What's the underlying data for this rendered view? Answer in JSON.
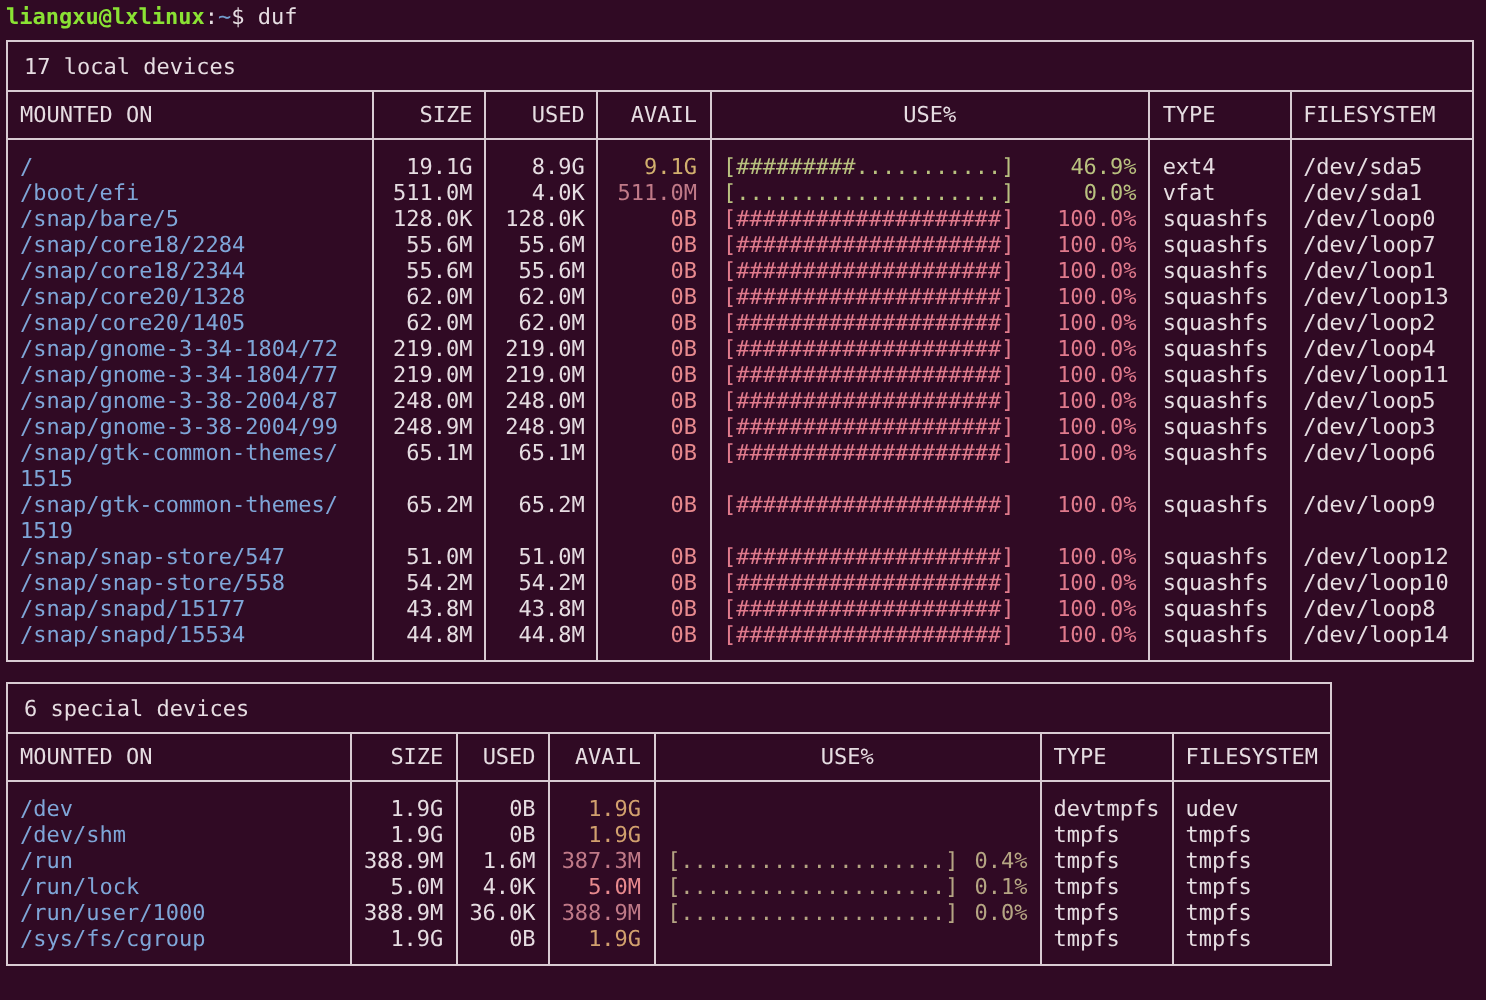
{
  "prompt": {
    "user_host": "liangxu@lxlinux",
    "separator": ":",
    "path": "~",
    "symbol": "$",
    "command": "duf"
  },
  "tables": [
    {
      "title": "17 local devices",
      "columns": [
        "MOUNTED ON",
        "SIZE",
        "USED",
        "AVAIL",
        "USE%",
        "TYPE",
        "FILESYSTEM"
      ],
      "rows": [
        {
          "mounted_on": "/",
          "size": "19.1G",
          "used": "8.9G",
          "avail": {
            "text": "9.1G",
            "color": "#d2b06e"
          },
          "use": {
            "bar": "[#########...........]",
            "percent": "46.9%",
            "color": "#b9c17f"
          },
          "type": "ext4",
          "filesystem": "/dev/sda5"
        },
        {
          "mounted_on": "/boot/efi",
          "size": "511.0M",
          "used": "4.0K",
          "avail": {
            "text": "511.0M",
            "color": "#c07a88"
          },
          "use": {
            "bar": "[....................]",
            "percent": "0.0%",
            "color": "#b9c17f"
          },
          "type": "vfat",
          "filesystem": "/dev/sda1"
        },
        {
          "mounted_on": "/snap/bare/5",
          "size": "128.0K",
          "used": "128.0K",
          "avail": {
            "text": "0B",
            "color": "#e88a8e"
          },
          "use": {
            "bar": "[####################]",
            "percent": "100.0%",
            "color": "#e07a8c"
          },
          "type": "squashfs",
          "filesystem": "/dev/loop0"
        },
        {
          "mounted_on": "/snap/core18/2284",
          "size": "55.6M",
          "used": "55.6M",
          "avail": {
            "text": "0B",
            "color": "#e88a8e"
          },
          "use": {
            "bar": "[####################]",
            "percent": "100.0%",
            "color": "#e07a8c"
          },
          "type": "squashfs",
          "filesystem": "/dev/loop7"
        },
        {
          "mounted_on": "/snap/core18/2344",
          "size": "55.6M",
          "used": "55.6M",
          "avail": {
            "text": "0B",
            "color": "#e88a8e"
          },
          "use": {
            "bar": "[####################]",
            "percent": "100.0%",
            "color": "#e07a8c"
          },
          "type": "squashfs",
          "filesystem": "/dev/loop1"
        },
        {
          "mounted_on": "/snap/core20/1328",
          "size": "62.0M",
          "used": "62.0M",
          "avail": {
            "text": "0B",
            "color": "#e88a8e"
          },
          "use": {
            "bar": "[####################]",
            "percent": "100.0%",
            "color": "#e07a8c"
          },
          "type": "squashfs",
          "filesystem": "/dev/loop13"
        },
        {
          "mounted_on": "/snap/core20/1405",
          "size": "62.0M",
          "used": "62.0M",
          "avail": {
            "text": "0B",
            "color": "#e88a8e"
          },
          "use": {
            "bar": "[####################]",
            "percent": "100.0%",
            "color": "#e07a8c"
          },
          "type": "squashfs",
          "filesystem": "/dev/loop2"
        },
        {
          "mounted_on": "/snap/gnome-3-34-1804/72",
          "size": "219.0M",
          "used": "219.0M",
          "avail": {
            "text": "0B",
            "color": "#e88a8e"
          },
          "use": {
            "bar": "[####################]",
            "percent": "100.0%",
            "color": "#e07a8c"
          },
          "type": "squashfs",
          "filesystem": "/dev/loop4"
        },
        {
          "mounted_on": "/snap/gnome-3-34-1804/77",
          "size": "219.0M",
          "used": "219.0M",
          "avail": {
            "text": "0B",
            "color": "#e88a8e"
          },
          "use": {
            "bar": "[####################]",
            "percent": "100.0%",
            "color": "#e07a8c"
          },
          "type": "squashfs",
          "filesystem": "/dev/loop11"
        },
        {
          "mounted_on": "/snap/gnome-3-38-2004/87",
          "size": "248.0M",
          "used": "248.0M",
          "avail": {
            "text": "0B",
            "color": "#e88a8e"
          },
          "use": {
            "bar": "[####################]",
            "percent": "100.0%",
            "color": "#e07a8c"
          },
          "type": "squashfs",
          "filesystem": "/dev/loop5"
        },
        {
          "mounted_on": "/snap/gnome-3-38-2004/99",
          "size": "248.9M",
          "used": "248.9M",
          "avail": {
            "text": "0B",
            "color": "#e88a8e"
          },
          "use": {
            "bar": "[####################]",
            "percent": "100.0%",
            "color": "#e07a8c"
          },
          "type": "squashfs",
          "filesystem": "/dev/loop3"
        },
        {
          "mounted_on": "/snap/gtk-common-themes/1515",
          "size": "65.1M",
          "used": "65.1M",
          "avail": {
            "text": "0B",
            "color": "#e88a8e"
          },
          "use": {
            "bar": "[####################]",
            "percent": "100.0%",
            "color": "#e07a8c"
          },
          "type": "squashfs",
          "filesystem": "/dev/loop6"
        },
        {
          "mounted_on": "/snap/gtk-common-themes/1519",
          "size": "65.2M",
          "used": "65.2M",
          "avail": {
            "text": "0B",
            "color": "#e88a8e"
          },
          "use": {
            "bar": "[####################]",
            "percent": "100.0%",
            "color": "#e07a8c"
          },
          "type": "squashfs",
          "filesystem": "/dev/loop9"
        },
        {
          "mounted_on": "/snap/snap-store/547",
          "size": "51.0M",
          "used": "51.0M",
          "avail": {
            "text": "0B",
            "color": "#e88a8e"
          },
          "use": {
            "bar": "[####################]",
            "percent": "100.0%",
            "color": "#e07a8c"
          },
          "type": "squashfs",
          "filesystem": "/dev/loop12"
        },
        {
          "mounted_on": "/snap/snap-store/558",
          "size": "54.2M",
          "used": "54.2M",
          "avail": {
            "text": "0B",
            "color": "#e88a8e"
          },
          "use": {
            "bar": "[####################]",
            "percent": "100.0%",
            "color": "#e07a8c"
          },
          "type": "squashfs",
          "filesystem": "/dev/loop10"
        },
        {
          "mounted_on": "/snap/snapd/15177",
          "size": "43.8M",
          "used": "43.8M",
          "avail": {
            "text": "0B",
            "color": "#e88a8e"
          },
          "use": {
            "bar": "[####################]",
            "percent": "100.0%",
            "color": "#e07a8c"
          },
          "type": "squashfs",
          "filesystem": "/dev/loop8"
        },
        {
          "mounted_on": "/snap/snapd/15534",
          "size": "44.8M",
          "used": "44.8M",
          "avail": {
            "text": "0B",
            "color": "#e88a8e"
          },
          "use": {
            "bar": "[####################]",
            "percent": "100.0%",
            "color": "#e07a8c"
          },
          "type": "squashfs",
          "filesystem": "/dev/loop14"
        }
      ]
    },
    {
      "title": "6 special devices",
      "columns": [
        "MOUNTED ON",
        "SIZE",
        "USED",
        "AVAIL",
        "USE%",
        "TYPE",
        "FILESYSTEM"
      ],
      "rows": [
        {
          "mounted_on": "/dev",
          "size": "1.9G",
          "used": "0B",
          "avail": {
            "text": "1.9G",
            "color": "#d2a06e"
          },
          "type": "devtmpfs",
          "filesystem": "udev"
        },
        {
          "mounted_on": "/dev/shm",
          "size": "1.9G",
          "used": "0B",
          "avail": {
            "text": "1.9G",
            "color": "#d2a06e"
          },
          "type": "tmpfs",
          "filesystem": "tmpfs"
        },
        {
          "mounted_on": "/run",
          "size": "388.9M",
          "used": "1.6M",
          "avail": {
            "text": "387.3M",
            "color": "#c07a88"
          },
          "use": {
            "bar": "[....................]",
            "percent": "0.4%",
            "color": "#b5a583"
          },
          "type": "tmpfs",
          "filesystem": "tmpfs"
        },
        {
          "mounted_on": "/run/lock",
          "size": "5.0M",
          "used": "4.0K",
          "avail": {
            "text": "5.0M",
            "color": "#e88a8e"
          },
          "use": {
            "bar": "[....................]",
            "percent": "0.1%",
            "color": "#b5a583"
          },
          "type": "tmpfs",
          "filesystem": "tmpfs"
        },
        {
          "mounted_on": "/run/user/1000",
          "size": "388.9M",
          "used": "36.0K",
          "avail": {
            "text": "388.9M",
            "color": "#c07a88"
          },
          "use": {
            "bar": "[....................]",
            "percent": "0.0%",
            "color": "#b5a583"
          },
          "type": "tmpfs",
          "filesystem": "tmpfs"
        },
        {
          "mounted_on": "/sys/fs/cgroup",
          "size": "1.9G",
          "used": "0B",
          "avail": {
            "text": "1.9G",
            "color": "#d2a06e"
          },
          "type": "tmpfs",
          "filesystem": "tmpfs"
        }
      ]
    }
  ]
}
